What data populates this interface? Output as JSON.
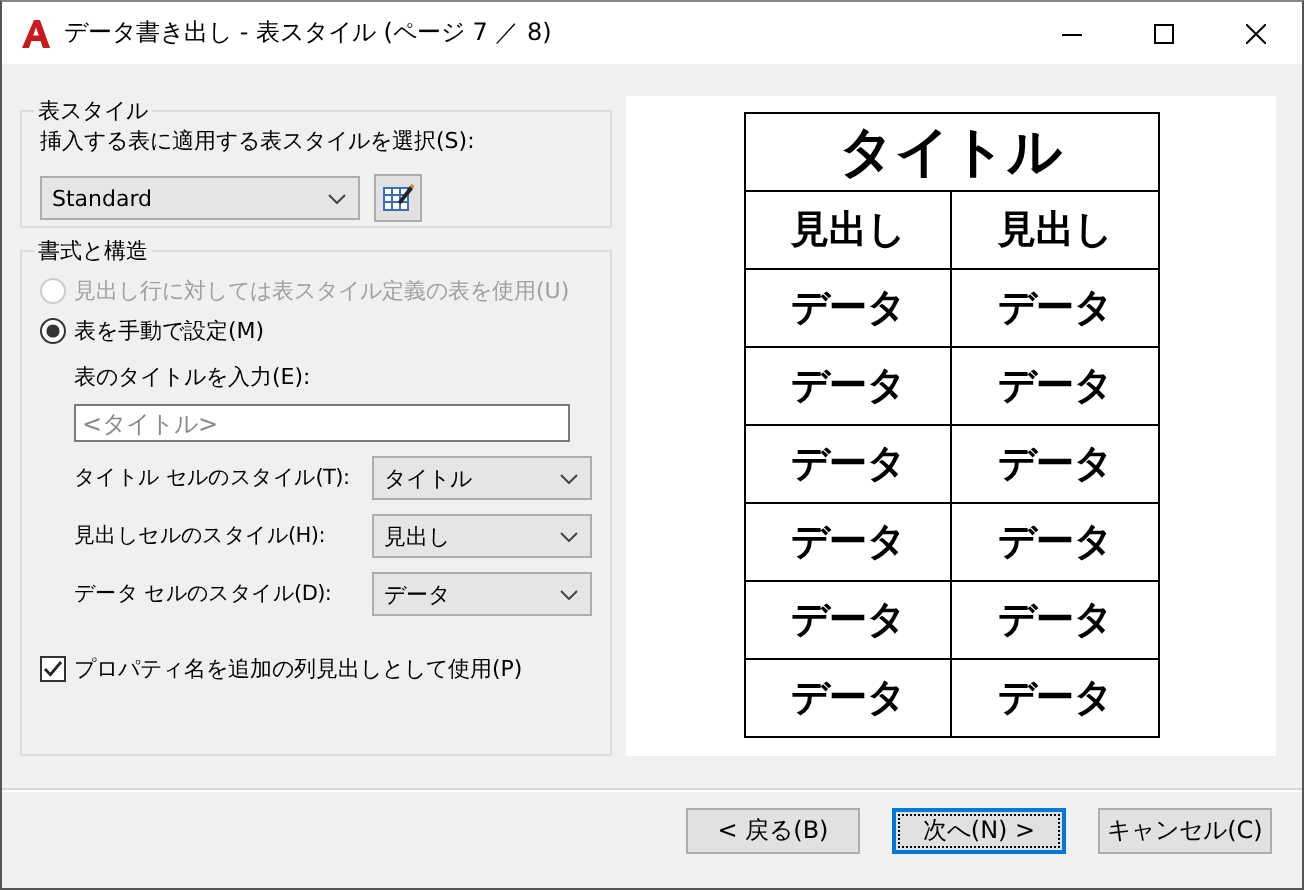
{
  "window": {
    "title": "データ書き出し - 表スタイル (ページ 7 ／ 8)"
  },
  "table_style": {
    "label": "表スタイル",
    "prompt": "挿入する表に適用する表スタイルを選択(S):",
    "style_select": {
      "value": "Standard"
    }
  },
  "format": {
    "label": "書式と構造",
    "options": [
      {
        "label": "見出し行に対しては表スタイル定義の表を使用(U)",
        "selected": false,
        "disabled": true
      },
      {
        "label": "表を手動で設定(M)",
        "selected": true,
        "disabled": false
      }
    ],
    "title_input": {
      "label": "表のタイトルを入力(E):",
      "placeholder": "<タイトル>"
    },
    "cell_styles": [
      {
        "label": "タイトル セルのスタイル(T):",
        "value": "タイトル"
      },
      {
        "label": "見出しセルのスタイル(H):",
        "value": "見出し"
      },
      {
        "label": "データ セルのスタイル(D):",
        "value": "データ"
      }
    ],
    "property_checkbox": {
      "label": "プロパティ名を追加の列見出しとして使用(P)",
      "checked": true
    }
  },
  "preview": {
    "title": "タイトル",
    "headers": [
      "見出し",
      "見出し"
    ],
    "rows": [
      [
        "データ",
        "データ"
      ],
      [
        "データ",
        "データ"
      ],
      [
        "データ",
        "データ"
      ],
      [
        "データ",
        "データ"
      ],
      [
        "データ",
        "データ"
      ],
      [
        "データ",
        "データ"
      ]
    ]
  },
  "buttons": [
    {
      "label": "< 戻る(B)",
      "default": false
    },
    {
      "label": "次へ(N) >",
      "default": true
    },
    {
      "label": "キャンセル(C)",
      "default": false
    }
  ]
}
